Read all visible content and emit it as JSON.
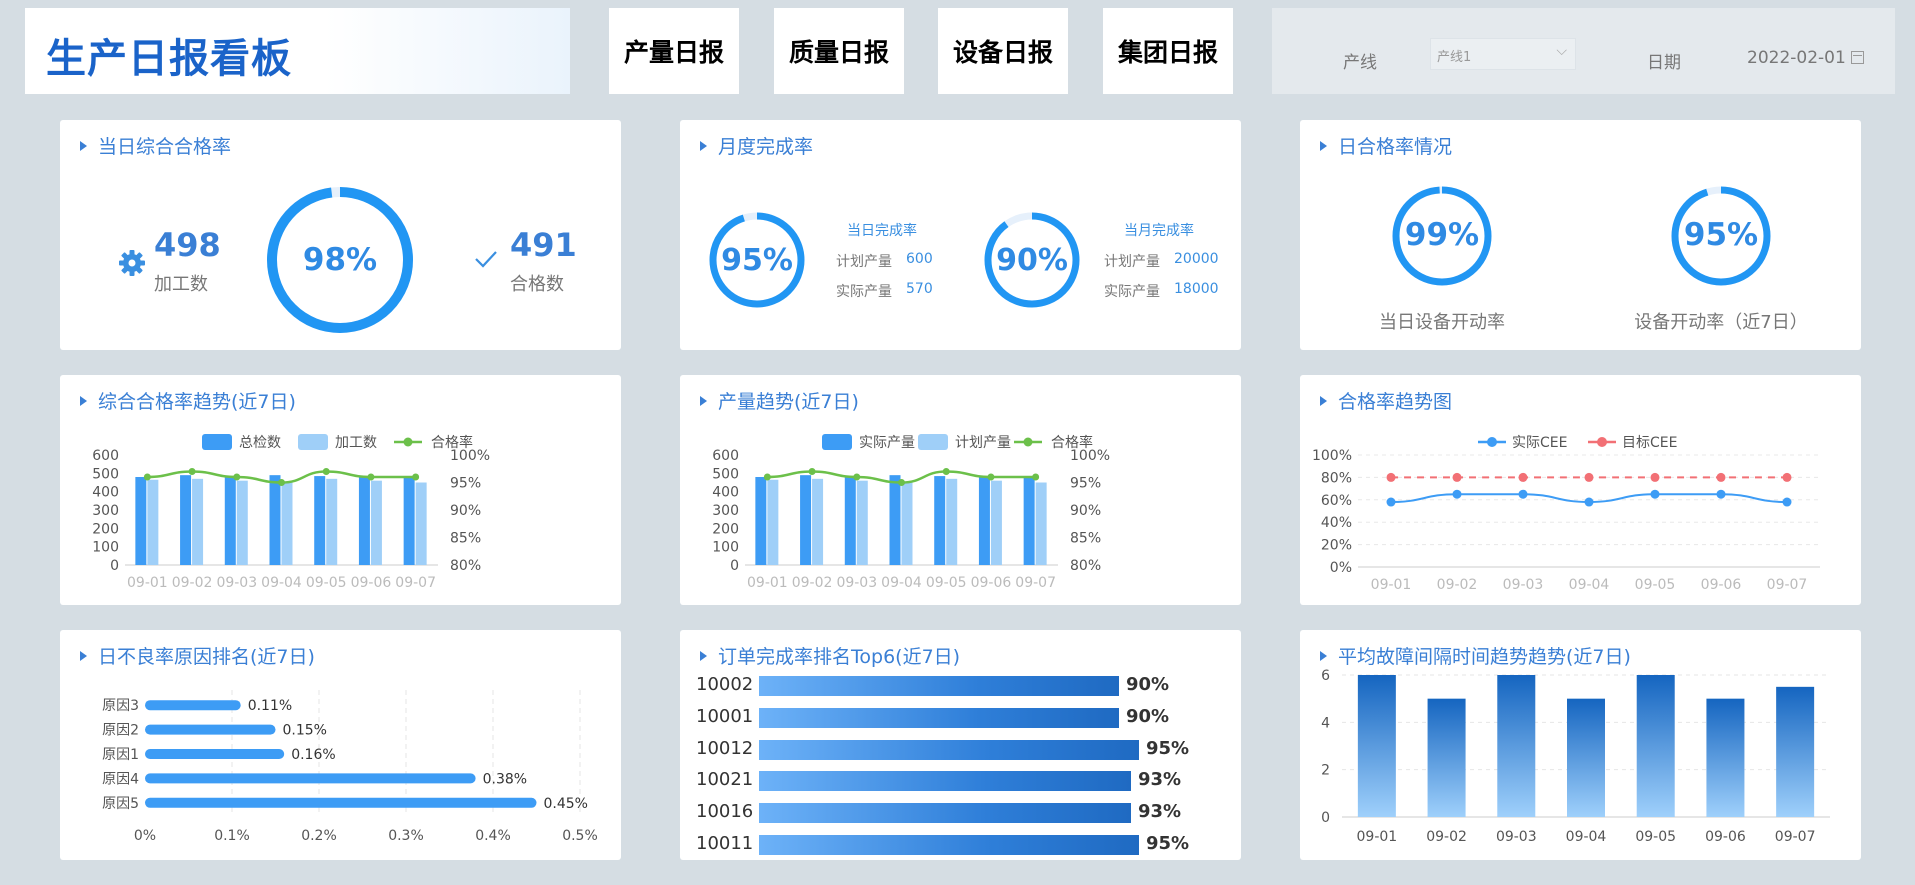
{
  "header": {
    "title": "生产日报看板",
    "tabs": [
      {
        "label": "产量日报"
      },
      {
        "label": "质量日报"
      },
      {
        "label": "设备日报"
      },
      {
        "label": "集团日报"
      }
    ],
    "filters": {
      "line_label": "产线",
      "line_value": "产线1",
      "date_label": "日期",
      "date_value": "2022-02-01"
    }
  },
  "colors": {
    "accent": "#3a7fd5",
    "ring": "#2196f3",
    "bar_dark": "#3d9cf5",
    "bar_light": "#9fcff8",
    "line_green": "#6cc04a",
    "target_red": "#f27075"
  },
  "daily_pass": {
    "title": "当日综合合格率",
    "processed_value": "498",
    "processed_label": "加工数",
    "rate": "98%",
    "passed_value": "491",
    "passed_label": "合格数",
    "rate_fraction": 0.98
  },
  "monthly_completion": {
    "title": "月度完成率",
    "day": {
      "rate": "95%",
      "rate_fraction": 0.95,
      "label": "当日完成率",
      "plan_label": "计划产量",
      "plan_value": "600",
      "actual_label": "实际产量",
      "actual_value": "570"
    },
    "month": {
      "rate": "90%",
      "rate_fraction": 0.9,
      "label": "当月完成率",
      "plan_label": "计划产量",
      "plan_value": "20000",
      "actual_label": "实际产量",
      "actual_value": "18000"
    }
  },
  "daily_equipment": {
    "title": "日合格率情况",
    "left": {
      "rate": "99%",
      "rate_fraction": 0.99,
      "label": "当日设备开动率"
    },
    "right": {
      "rate": "95%",
      "rate_fraction": 0.95,
      "label": "设备开动率（近7日）"
    }
  },
  "bottom_titles": {
    "pass_trend": "综合合格率趋势(近7日)",
    "output_trend": "产量趋势(近7日)",
    "cee_trend": "合格率趋势图",
    "defect_rank": "日不良率原因排名(近7日)",
    "order_rank": "订单完成率排名Top6(近7日)",
    "mtbf_trend": "平均故障间隔时间趋势趋势(近7日)"
  },
  "chart_data": [
    {
      "id": "pass_trend",
      "type": "bar",
      "categories": [
        "09-01",
        "09-02",
        "09-03",
        "09-04",
        "09-05",
        "09-06",
        "09-07"
      ],
      "series": [
        {
          "name": "总检数",
          "kind": "bar",
          "values": [
            480,
            490,
            480,
            490,
            485,
            480,
            475
          ]
        },
        {
          "name": "加工数",
          "kind": "bar",
          "values": [
            465,
            470,
            460,
            455,
            470,
            460,
            450
          ]
        },
        {
          "name": "合格率",
          "kind": "line",
          "axis": "right",
          "values": [
            96,
            97,
            96,
            95,
            97,
            96,
            96
          ]
        }
      ],
      "ylim": [
        0,
        600
      ],
      "yticks": [
        0,
        100,
        200,
        300,
        400,
        500,
        600
      ],
      "y2lim": [
        80,
        100
      ],
      "y2ticks": [
        "80%",
        "85%",
        "90%",
        "95%",
        "100%"
      ],
      "legend": "top-center"
    },
    {
      "id": "output_trend",
      "type": "bar",
      "categories": [
        "09-01",
        "09-02",
        "09-03",
        "09-04",
        "09-05",
        "09-06",
        "09-07"
      ],
      "series": [
        {
          "name": "实际产量",
          "kind": "bar",
          "values": [
            480,
            490,
            480,
            490,
            485,
            480,
            475
          ]
        },
        {
          "name": "计划产量",
          "kind": "bar",
          "values": [
            465,
            470,
            460,
            455,
            470,
            460,
            450
          ]
        },
        {
          "name": "合格率",
          "kind": "line",
          "axis": "right",
          "values": [
            96,
            97,
            96,
            95,
            97,
            96,
            96
          ]
        }
      ],
      "ylim": [
        0,
        600
      ],
      "yticks": [
        0,
        100,
        200,
        300,
        400,
        500,
        600
      ],
      "y2lim": [
        80,
        100
      ],
      "y2ticks": [
        "80%",
        "85%",
        "90%",
        "95%",
        "100%"
      ],
      "legend": "top-center"
    },
    {
      "id": "cee_trend",
      "type": "line",
      "categories": [
        "09-01",
        "09-02",
        "09-03",
        "09-04",
        "09-05",
        "09-06",
        "09-07"
      ],
      "series": [
        {
          "name": "实际CEE",
          "values": [
            58,
            65,
            65,
            58,
            65,
            65,
            58
          ]
        },
        {
          "name": "目标CEE",
          "dashed": true,
          "values": [
            80,
            80,
            80,
            80,
            80,
            80,
            80
          ]
        }
      ],
      "ylim": [
        0,
        100
      ],
      "yticks": [
        "0%",
        "20%",
        "40%",
        "60%",
        "80%",
        "100%"
      ],
      "legend": "top-center"
    },
    {
      "id": "defect_rank",
      "type": "bar",
      "orientation": "horizontal",
      "categories": [
        "原因3",
        "原因2",
        "原因1",
        "原因4",
        "原因5"
      ],
      "values": [
        0.11,
        0.15,
        0.16,
        0.38,
        0.45
      ],
      "labels": [
        "0.11%",
        "0.15%",
        "0.16%",
        "0.38%",
        "0.45%"
      ],
      "xlim": [
        0,
        0.5
      ],
      "xticks": [
        "0%",
        "0.1%",
        "0.2%",
        "0.3%",
        "0.4%",
        "0.5%"
      ]
    },
    {
      "id": "order_rank",
      "type": "bar",
      "orientation": "horizontal",
      "categories": [
        "10002",
        "10001",
        "10012",
        "10021",
        "10016",
        "10011"
      ],
      "values": [
        90,
        90,
        95,
        93,
        93,
        95
      ],
      "labels": [
        "90%",
        "90%",
        "95%",
        "93%",
        "93%",
        "95%"
      ]
    },
    {
      "id": "mtbf_trend",
      "type": "bar",
      "categories": [
        "09-01",
        "09-02",
        "09-03",
        "09-04",
        "09-05",
        "09-06",
        "09-07"
      ],
      "values": [
        6,
        5,
        6,
        5,
        6,
        5,
        5.5
      ],
      "ylim": [
        0,
        6
      ],
      "yticks": [
        0,
        2,
        4,
        6
      ]
    }
  ]
}
